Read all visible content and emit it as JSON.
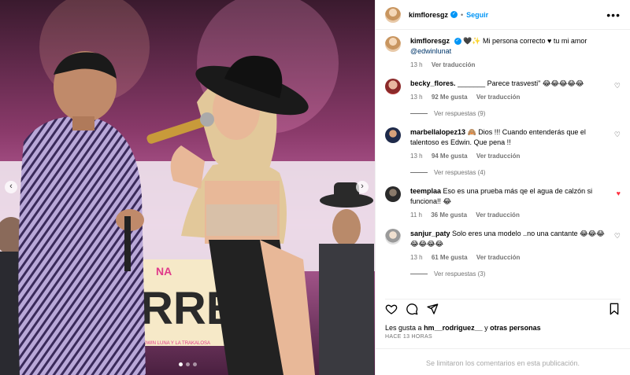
{
  "post": {
    "username": "kimfloresgz",
    "separator": "•",
    "follow_label": "Seguir",
    "more_icon": "more-horizontal-icon"
  },
  "caption": {
    "username": "kimfloresgz",
    "text": "🖤✨ Mi persona correcto ♥ tu mi amor",
    "mention": "@edwinlunat",
    "age": "13 h",
    "translate": "Ver traducción"
  },
  "comments": [
    {
      "username": "becky_flores.",
      "text": "_______ Parece trasvesti\" 😂😂😂😂😂",
      "age": "13 h",
      "likes": "92 Me gusta",
      "translate": "Ver traducción",
      "replies": "Ver respuestas (9)",
      "liked": false
    },
    {
      "username": "marbellalopez13",
      "text": "🙈 Dios !!! Cuando entenderás que el talentoso es Edwin. Que pena !!",
      "age": "13 h",
      "likes": "94 Me gusta",
      "translate": "Ver traducción",
      "replies": "Ver respuestas (4)",
      "liked": false
    },
    {
      "username": "teemplaa",
      "text": "Eso es una prueba más qe el agua de calzón si funciona!! 😂",
      "age": "11 h",
      "likes": "36 Me gusta",
      "translate": "Ver traducción",
      "replies": "",
      "liked": true
    },
    {
      "username": "sanjur_paty",
      "text": "Solo eres una modelo ..no una cantante 😂😂😂😂😂😂😂",
      "age": "13 h",
      "likes": "61 Me gusta",
      "translate": "Ver traducción",
      "replies": "Ver respuestas (3)",
      "liked": false
    }
  ],
  "likes_line": {
    "prefix": "Les gusta a",
    "user": "hm__rodriguez__",
    "middle": "y",
    "others": "otras personas"
  },
  "timestamp": "HACE 13 HORAS",
  "comments_limited": "Se limitaron los comentarios en esta publicación.",
  "media": {
    "banner_text": "RREG",
    "banner_sub": "EDWIN LUNA Y LA TRAKALOSA",
    "banner_small": "NA"
  },
  "colors": {
    "accent": "#0095f6",
    "liked": "#ff3040",
    "muted": "#737373"
  }
}
